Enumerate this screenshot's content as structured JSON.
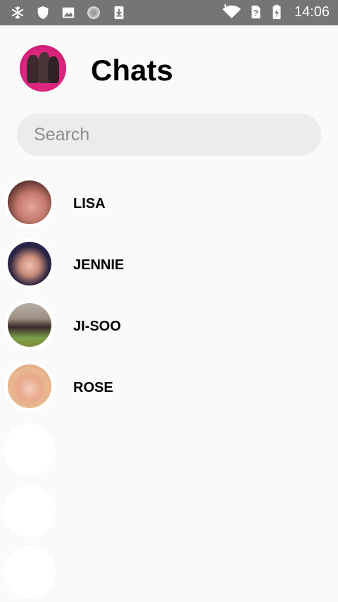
{
  "status_bar": {
    "time": "14:06",
    "left_icons": [
      "snowflake-icon",
      "shield-icon",
      "image-icon",
      "circle-icon",
      "download-icon"
    ],
    "right_icons": [
      "wifi-icon",
      "sim-unknown-icon",
      "battery-charging-icon"
    ]
  },
  "header": {
    "title": "Chats",
    "avatar_icon": "profile-avatar"
  },
  "search": {
    "placeholder": "Search",
    "value": ""
  },
  "chats": [
    {
      "name": "LISA"
    },
    {
      "name": "JENNIE"
    },
    {
      "name": "JI-SOO"
    },
    {
      "name": "ROSE"
    }
  ],
  "colors": {
    "status_bar": "#757575",
    "background": "#fafafa",
    "search_bg": "#ececec",
    "title": "#000000"
  }
}
